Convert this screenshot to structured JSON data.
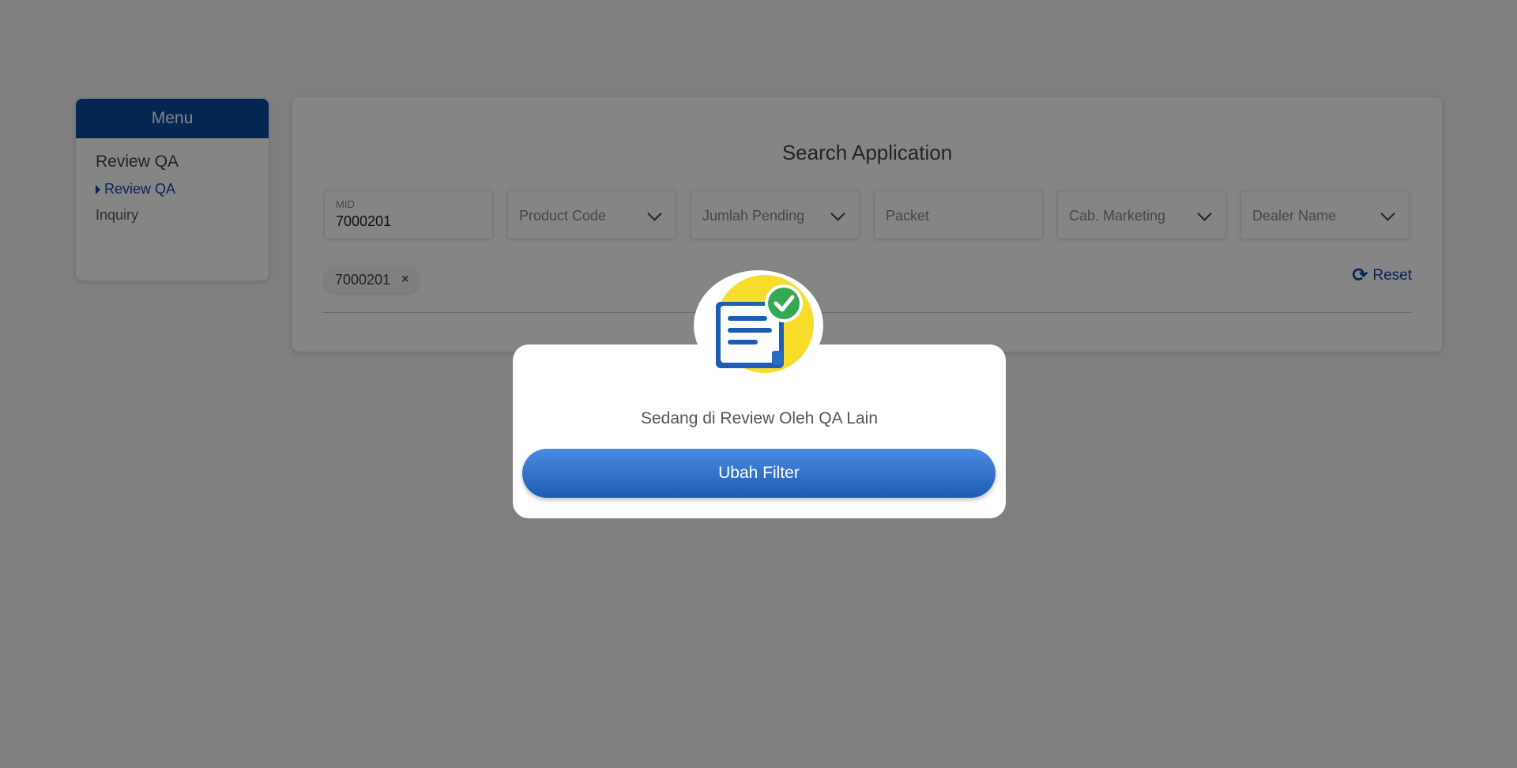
{
  "sidebar": {
    "title": "Menu",
    "group_label": "Review QA",
    "items": [
      {
        "label": "Review QA",
        "active": true
      },
      {
        "label": "Inquiry",
        "active": false
      }
    ]
  },
  "search": {
    "title": "Search Application",
    "fields": {
      "mid": {
        "label": "MID",
        "value": "7000201"
      },
      "product_code": {
        "placeholder": "Product Code"
      },
      "jumlah_pending": {
        "placeholder": "Jumlah Pending"
      },
      "packet": {
        "placeholder": "Packet"
      },
      "cab_marketing": {
        "placeholder": "Cab. Marketing"
      },
      "dealer_name": {
        "placeholder": "Dealer Name"
      }
    },
    "chip": {
      "label": "7000201",
      "remove": "×"
    },
    "reset_label": "Reset"
  },
  "modal": {
    "message": "Sedang di Review Oleh QA Lain",
    "button_label": "Ubah Filter",
    "icon": "document-check-icon"
  },
  "colors": {
    "brand": "#0b4aa0",
    "button": "#2f6fc9",
    "check": "#34a853",
    "illustration_bg": "#f7dc2a"
  }
}
